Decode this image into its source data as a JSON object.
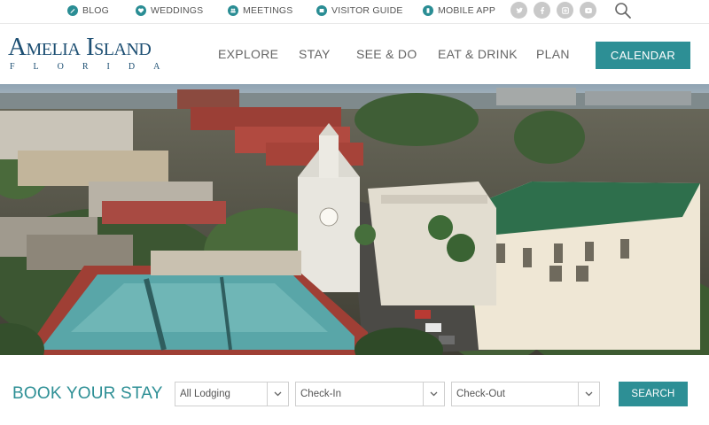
{
  "utility_nav": {
    "items": [
      {
        "label": "BLOG",
        "icon": "pencil-icon"
      },
      {
        "label": "WEDDINGS",
        "icon": "heart-icon"
      },
      {
        "label": "MEETINGS",
        "icon": "people-icon"
      },
      {
        "label": "VISITOR GUIDE",
        "icon": "book-icon"
      },
      {
        "label": "MOBILE APP",
        "icon": "phone-icon"
      }
    ],
    "social": [
      "twitter-icon",
      "facebook-icon",
      "instagram-icon",
      "youtube-icon"
    ],
    "search_icon": "search-icon"
  },
  "brand": {
    "name": "Amelia Island",
    "subtitle": "FLORIDA"
  },
  "main_nav": {
    "items": [
      "EXPLORE",
      "STAY",
      "SEE & DO",
      "EAT & DRINK",
      "PLAN"
    ],
    "cta": "CALENDAR"
  },
  "booking": {
    "title": "BOOK YOUR STAY",
    "lodging_value": "All Lodging",
    "checkin_placeholder": "Check-In",
    "checkout_placeholder": "Check-Out",
    "search_label": "SEARCH"
  },
  "colors": {
    "accent": "#2d8f95",
    "brand_navy": "#1d4f73",
    "text_gray": "#666666",
    "social_gray": "#c9c9c9"
  }
}
